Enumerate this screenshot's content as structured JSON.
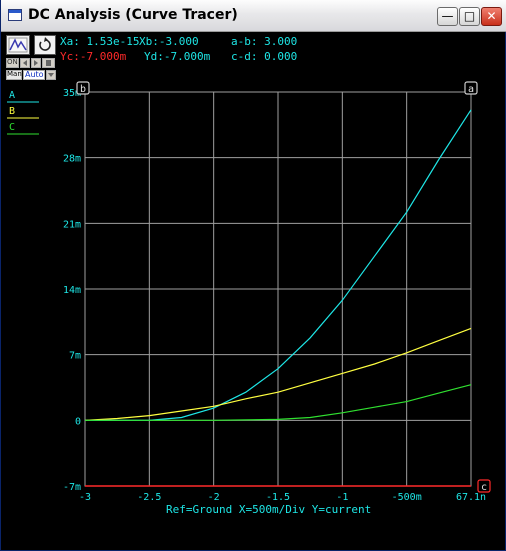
{
  "window": {
    "title": "DC Analysis (Curve Tracer)",
    "min_glyph": "—",
    "max_glyph": "□",
    "close_glyph": "✕"
  },
  "toolbar": {
    "scope_icon": "cursor-icon",
    "reset_icon": "refresh-icon",
    "man_label": "Man",
    "auto_label": "Auto"
  },
  "readouts": {
    "xa": "Xa: 1.53e-15",
    "xb": "Xb:-3.000",
    "ab": "a-b: 3.000",
    "yc": "Yc:-7.000m",
    "yd": "Yd:-7.000m",
    "cd": "c-d: 0.000"
  },
  "cursors": {
    "a": "a",
    "b": "b",
    "c": "c"
  },
  "footer": "Ref=Ground  X=500m/Div Y=current",
  "colors": {
    "grid": "#a0a0a0",
    "axis_text": "#1ee6e6",
    "cursor_c": "#ff2a2a",
    "series_A": "#1ee6e6",
    "series_B": "#ffff40",
    "series_C": "#30e030"
  },
  "chart_data": {
    "type": "line",
    "xlim": [
      -3,
      0
    ],
    "ylim": [
      -0.007,
      0.035
    ],
    "x_ticks": [
      -3,
      -2.5,
      -2,
      -1.5,
      -1,
      -0.5,
      0
    ],
    "x_tick_labels": [
      "-3",
      "-2.5",
      "-2",
      "-1.5",
      "-1",
      "-500m",
      "67.1n"
    ],
    "y_ticks": [
      0.035,
      0.028,
      0.021,
      0.014,
      0.007,
      0,
      -0.007
    ],
    "y_tick_labels": [
      "35m",
      "28m",
      "21m",
      "14m",
      "7m",
      "0",
      "-7m"
    ],
    "grid": true,
    "legend": "left",
    "x": [
      -3,
      -2.75,
      -2.5,
      -2.25,
      -2,
      -1.75,
      -1.5,
      -1.25,
      -1,
      -0.75,
      -0.5,
      -0.25,
      0
    ],
    "series": [
      {
        "name": "A",
        "color": "#1ee6e6",
        "values": [
          0,
          0,
          0,
          0.0003,
          0.0013,
          0.003,
          0.0055,
          0.0088,
          0.0128,
          0.0175,
          0.0222,
          0.0278,
          0.0331
        ]
      },
      {
        "name": "B",
        "color": "#ffff40",
        "values": [
          0,
          0.0002,
          0.0005,
          0.001,
          0.0015,
          0.0023,
          0.003,
          0.004,
          0.005,
          0.006,
          0.0072,
          0.0085,
          0.0098
        ]
      },
      {
        "name": "C",
        "color": "#30e030",
        "values": [
          0,
          0,
          0,
          0,
          0,
          5e-05,
          0.0001,
          0.0003,
          0.0008,
          0.0014,
          0.002,
          0.0029,
          0.0038
        ]
      }
    ]
  }
}
